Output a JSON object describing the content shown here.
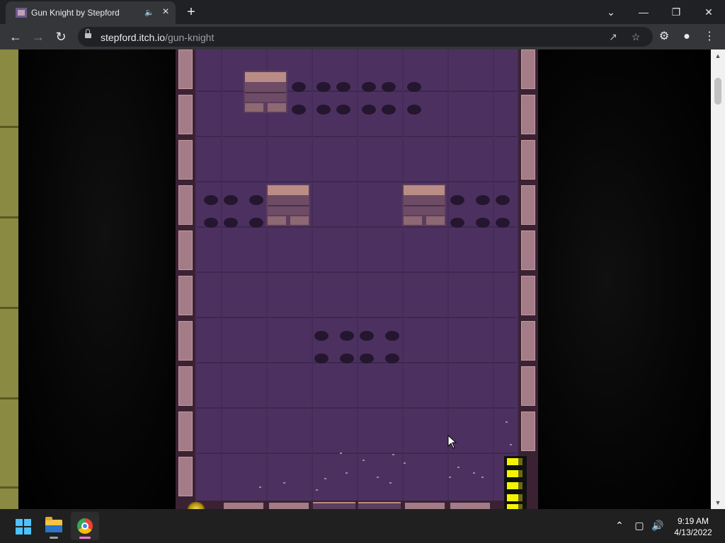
{
  "browser": {
    "tab": {
      "title": "Gun Knight by Stepford"
    },
    "url": {
      "host": "stepford.itch.io",
      "path": "/gun-knight"
    }
  },
  "icons": {
    "tab_favicon": "game-favicon-icon",
    "tab_audio": "speaker-icon",
    "tab_close": "close-icon",
    "new_tab": "plus-icon",
    "window_controls": [
      "chevron-down-icon",
      "minimize-icon",
      "restore-icon",
      "close-icon"
    ],
    "nav": [
      "back-arrow-icon",
      "forward-arrow-icon",
      "reload-icon"
    ],
    "omnibox": [
      "lock-icon",
      "share-icon",
      "star-icon"
    ],
    "toolbar": [
      "extensions-icon",
      "profile-icon",
      "menu-kebab-icon"
    ],
    "taskbar": [
      "windows-start-icon",
      "file-explorer-icon",
      "chrome-icon"
    ],
    "tray": [
      "chevron-up-icon",
      "network-icon",
      "volume-icon"
    ]
  },
  "game": {
    "name": "Gun Knight",
    "health_bars_visible": 5
  },
  "taskbar": {
    "time": "9:19 AM",
    "date": "4/13/2022"
  },
  "colors": {
    "floor": "#4c3160",
    "wall_brick": "#a37c87",
    "hp_bar": "#f4f400",
    "accent_chrome_active": "#ff7ad6"
  }
}
